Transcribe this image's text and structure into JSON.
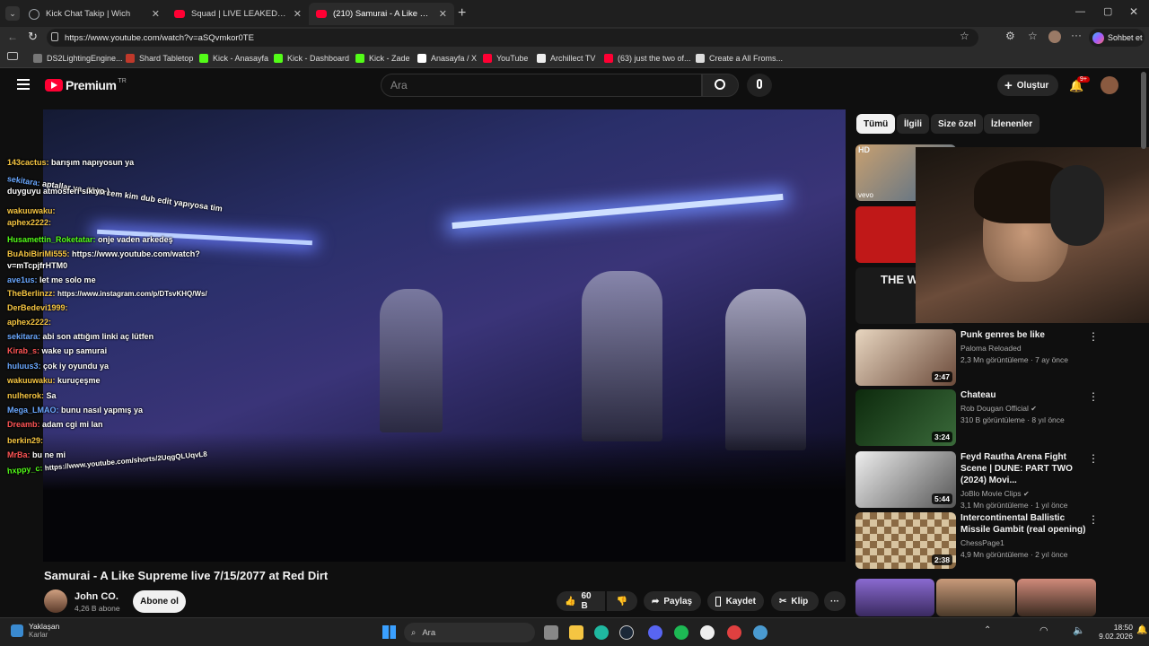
{
  "browser": {
    "tabs": [
      {
        "title": "Kick Chat Takip | Wich",
        "icon": "globe-icon",
        "color": "#9aa0a6"
      },
      {
        "title": "Squad | LIVE LEAKED Insurgent Fo",
        "icon": "youtube-icon",
        "color": "#ff0033"
      },
      {
        "title": "(210) Samurai - A Like Supreme li",
        "icon": "youtube-icon",
        "color": "#ff0033"
      }
    ],
    "url": "https://www.youtube.com/watch?v=aSQvmkor0TE",
    "chat_button": "Sohbet et",
    "bookmarks": [
      {
        "label": "DS2LightingEngine...",
        "color": "#777777"
      },
      {
        "label": "Shard Tabletop",
        "color": "#c0392b"
      },
      {
        "label": "Kick - Anasayfa",
        "color": "#53fc18"
      },
      {
        "label": "Kick - Dashboard",
        "color": "#53fc18"
      },
      {
        "label": "Kick - Zade",
        "color": "#53fc18"
      },
      {
        "label": "Anasayfa / X",
        "color": "#ffffff"
      },
      {
        "label": "YouTube",
        "color": "#ff0033"
      },
      {
        "label": "Archillect TV",
        "color": "#eeeeee"
      },
      {
        "label": "(63) just the two of...",
        "color": "#ff0033"
      },
      {
        "label": "Create a All Froms...",
        "color": "#dddddd"
      }
    ]
  },
  "youtube": {
    "logo": "Premium",
    "region": "TR",
    "search_placeholder": "Ara",
    "create_label": "Oluştur",
    "notif_count": "9+",
    "chips": [
      "Tümü",
      "İlgili",
      "Size özel",
      "İzlenenler"
    ],
    "video": {
      "title": "Samurai - A Like Supreme live 7/15/2077 at Red Dirt",
      "channel": "John CO.",
      "subs": "4,26 B abone",
      "subscribe": "Abone ol",
      "likes": "60 B",
      "share": "Paylaş",
      "save": "Kaydet",
      "clip": "Klip"
    },
    "recs": [
      {
        "title": "Punk genres be like",
        "channel": "Paloma Reloaded",
        "meta": "2,3 Mn görüntüleme · 7 ay önce",
        "duration": "2:47",
        "verified": false,
        "thumb": "#6b4a3a"
      },
      {
        "title": "Chateau",
        "channel": "Rob Dougan Official",
        "meta": "310 B görüntüleme · 8 yıl önce",
        "duration": "3:24",
        "verified": true,
        "thumb": "#1e3b1e"
      },
      {
        "title": "Feyd Rautha Arena Fight Scene | DUNE: PART TWO (2024) Movi...",
        "channel": "JoBlo Movie Clips",
        "meta": "3,1 Mn görüntüleme · 1 yıl önce",
        "duration": "5:44",
        "verified": true,
        "thumb": "#cfcfcf"
      },
      {
        "title": "Intercontinental Ballistic Missile Gambit (real opening)",
        "channel": "ChessPage1",
        "meta": "4,9 Mn görüntüleme · 2 yıl önce",
        "duration": "2:38",
        "verified": false,
        "thumb": "#d8c4a0"
      }
    ],
    "top_thumb_labels": {
      "hd": "HD",
      "vevo": "vevo",
      "the_wall": "THE WA"
    }
  },
  "chat": [
    {
      "user": "143cactus:",
      "msg": "barışım napıyosun ya",
      "color": "#f5c542"
    },
    {
      "user": "sekitara:",
      "msg": "aptallar ya, öldürcem kim dub edit yapıyosa tim",
      "color": "#6aa8ff"
    },
    {
      "user": "",
      "msg": "duyguyu atmosferi sikiyo )",
      "color": "#ffffff"
    },
    {
      "user": "wakuuwaku:",
      "msg": "",
      "color": "#f5c542"
    },
    {
      "user": "aphex2222:",
      "msg": "",
      "color": "#f5c542"
    },
    {
      "user": "Husamettin_Roketatar:",
      "msg": "onje vaden arkedeş",
      "color": "#53fc18"
    },
    {
      "user": "BuAbiBiriMi555:",
      "msg": "https://www.youtube.com/watch?",
      "color": "#f5c542"
    },
    {
      "user": "",
      "msg": "v=mTcpjfrHTM0",
      "color": "#ffffff"
    },
    {
      "user": "ave1us:",
      "msg": "let me solo me",
      "color": "#6aa8ff"
    },
    {
      "user": "TheBerlinzz:",
      "msg": "https://www.instagram.com/p/DTsvKHQ/Ws/",
      "color": "#f5c542"
    },
    {
      "user": "DerBedevi1999:",
      "msg": "",
      "color": "#f5c542"
    },
    {
      "user": "aphex2222:",
      "msg": "",
      "color": "#f5c542"
    },
    {
      "user": "sekitara:",
      "msg": "abi son attığım linki aç lütfen",
      "color": "#6aa8ff"
    },
    {
      "user": "Kirab_s:",
      "msg": "wake up samurai",
      "color": "#ff5555"
    },
    {
      "user": "huluus3:",
      "msg": "çok iy oyundu ya",
      "color": "#6aa8ff"
    },
    {
      "user": "wakuuwaku:",
      "msg": "kuruçeşme",
      "color": "#f5c542"
    },
    {
      "user": "nulherok:",
      "msg": "Sa",
      "color": "#f5c542"
    },
    {
      "user": "Mega_LMAO:",
      "msg": "bunu nasıl yapmış ya",
      "color": "#6aa8ff"
    },
    {
      "user": "Dreamb:",
      "msg": "adam cgi mi lan",
      "color": "#ff5555"
    },
    {
      "user": "berkin29:",
      "msg": "",
      "color": "#f5c542"
    },
    {
      "user": "MrBa:",
      "msg": "bu ne mi",
      "color": "#ff5555"
    },
    {
      "user": "hxppy_c:",
      "msg": "https://www.youtube.com/shorts/2UqgQLUqvL8",
      "color": "#53fc18"
    }
  ],
  "taskbar": {
    "weather_title": "Yaklaşan",
    "weather_sub": "Karlar",
    "search": "Ara",
    "time": "18:50",
    "date": "9.02.2026"
  }
}
